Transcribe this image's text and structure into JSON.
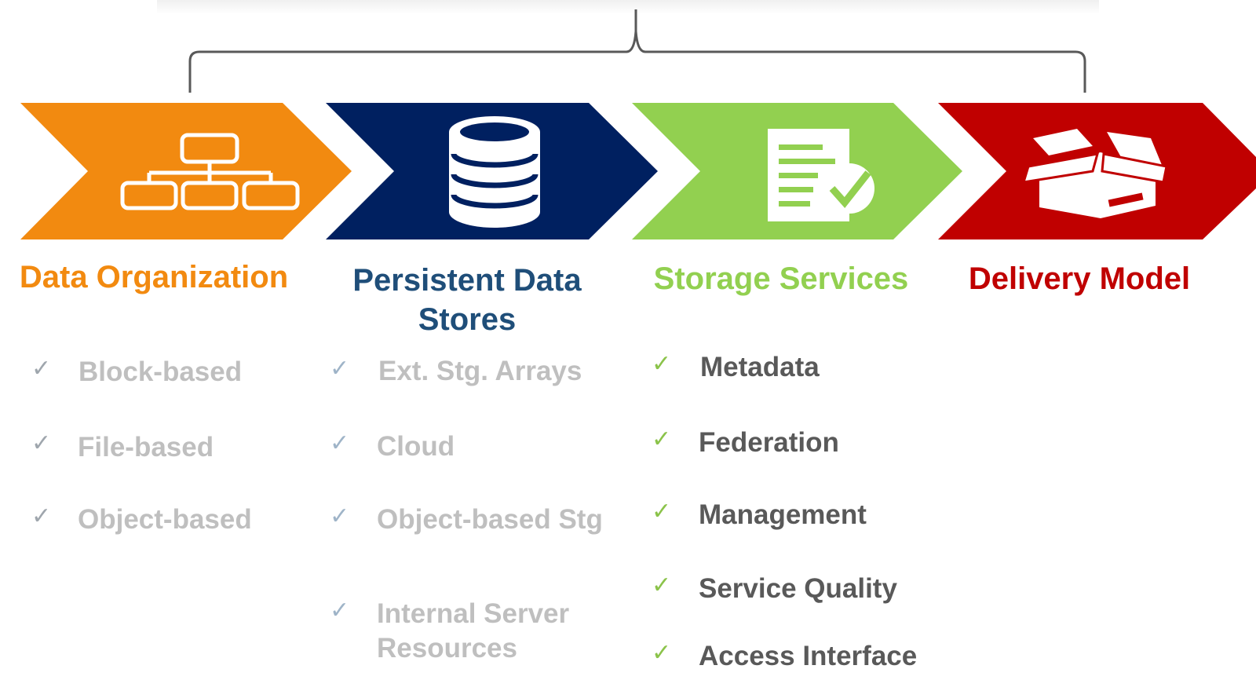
{
  "colors": {
    "orange": "#F28A10",
    "navy": "#002060",
    "navy_text": "#1F4E79",
    "green": "#92D050",
    "green_text": "#92D050",
    "red": "#C00000",
    "muted_text": "#BFBFBF",
    "muted_check": "#9FB4C8",
    "active_text": "#595959",
    "active_check": "#8BC34A",
    "bracket": "#595959"
  },
  "stages": [
    {
      "icon": "hierarchy-icon",
      "title": "Data Organization",
      "items": [
        "Block-based",
        "File-based",
        "Object-based"
      ],
      "state": "muted"
    },
    {
      "icon": "database-icon",
      "title": "Persistent Data Stores",
      "items": [
        "Ext. Stg. Arrays",
        "Cloud",
        "Object-based Stg",
        "Internal Server Resources"
      ],
      "state": "muted"
    },
    {
      "icon": "document-check-icon",
      "title": "Storage Services",
      "items": [
        "Metadata",
        "Federation",
        "Management",
        "Service Quality",
        "Access Interface"
      ],
      "state": "active"
    },
    {
      "icon": "open-box-icon",
      "title": "Delivery Model",
      "items": [],
      "state": "active"
    }
  ],
  "check_glyph": "✓"
}
